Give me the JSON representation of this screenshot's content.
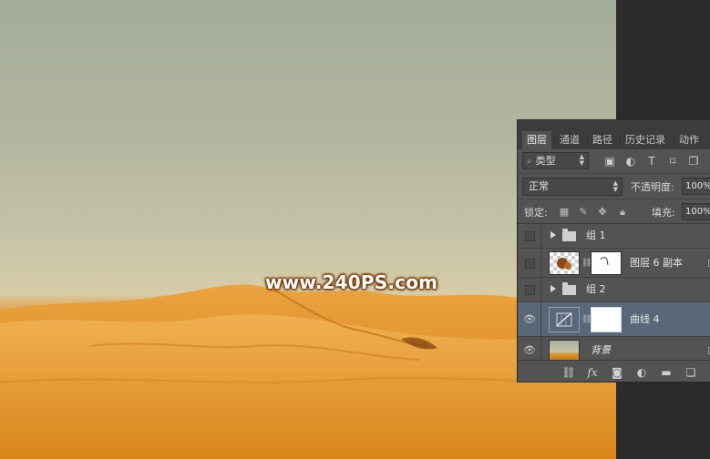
{
  "canvas": {
    "watermark": "www.240PS.com"
  },
  "panel": {
    "tabs": [
      {
        "label": "图层",
        "active": true
      },
      {
        "label": "通道",
        "active": false
      },
      {
        "label": "路径",
        "active": false
      },
      {
        "label": "历史记录",
        "active": false
      },
      {
        "label": "动作",
        "active": false
      }
    ],
    "filter": {
      "kind_label": "类型",
      "icons": [
        "image-filter-icon",
        "adjustment-filter-icon",
        "type-filter-icon",
        "shape-filter-icon",
        "smart-object-filter-icon"
      ]
    },
    "blend_mode": "正常",
    "opacity_label": "不透明度:",
    "opacity_value": "100%",
    "lock_label": "锁定:",
    "fill_label": "填充:",
    "fill_value": "100%",
    "layers": [
      {
        "name": "组 1",
        "type": "group",
        "visible": false,
        "selected": false
      },
      {
        "name": "图层 6 副本",
        "type": "pixel",
        "visible": false,
        "selected": false
      },
      {
        "name": "组 2",
        "type": "group",
        "visible": false,
        "selected": false
      },
      {
        "name": "曲线 4",
        "type": "curves",
        "visible": true,
        "selected": true
      },
      {
        "name": "背景",
        "type": "background",
        "visible": true,
        "selected": false
      }
    ],
    "bottom_icons": [
      "link-layers-icon",
      "fx-icon",
      "add-mask-icon",
      "adjustment-icon",
      "new-group-icon",
      "new-layer-icon"
    ],
    "fx_label": "fx"
  }
}
